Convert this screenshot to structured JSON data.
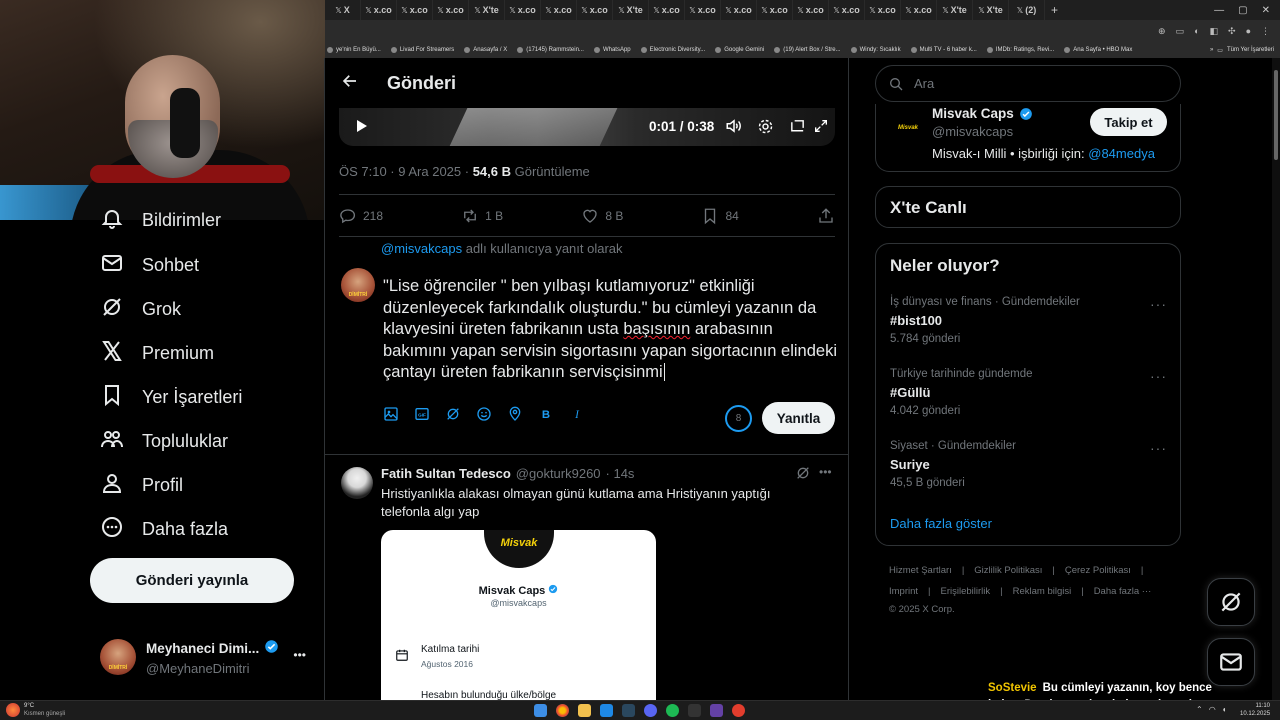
{
  "browser": {
    "tabs": [
      {
        "label": "X"
      },
      {
        "label": "x.co"
      },
      {
        "label": "x.co"
      },
      {
        "label": "x.co"
      },
      {
        "label": "X'te"
      },
      {
        "label": "x.co"
      },
      {
        "label": "x.co"
      },
      {
        "label": "x.co"
      },
      {
        "label": "X'te"
      },
      {
        "label": "x.co"
      },
      {
        "label": "x.co"
      },
      {
        "label": "x.co"
      },
      {
        "label": "x.co"
      },
      {
        "label": "x.co"
      },
      {
        "label": "x.co"
      },
      {
        "label": "x.co"
      },
      {
        "label": "x.co"
      },
      {
        "label": "X'te"
      },
      {
        "label": "X'te"
      },
      {
        "label": "(2)"
      }
    ],
    "new_tab": "+",
    "bookmarks": [
      "ye'nin En Büyü...",
      "Livad For Streamers",
      "Anasayfa / X",
      "(17145) Rammstein...",
      "WhatsApp",
      "Electronic Diversity...",
      "Google Gemini",
      "(19) Alert Box / Stre...",
      "Windy: Sıcaklık",
      "Multi TV - 6 haber k...",
      "IMDb: Ratings, Revi...",
      "Ana Sayfa • HBO Max"
    ],
    "bookmarks_more": "»",
    "all_bookmarks": "Tüm Yer İşaretleri"
  },
  "sidebar": {
    "items": [
      {
        "label": "Bildirimler",
        "icon": "bell-icon"
      },
      {
        "label": "Sohbet",
        "icon": "mail-icon"
      },
      {
        "label": "Grok",
        "icon": "grok-icon"
      },
      {
        "label": "Premium",
        "icon": "x-logo-icon"
      },
      {
        "label": "Yer İşaretleri",
        "icon": "bookmark-icon"
      },
      {
        "label": "Topluluklar",
        "icon": "communities-icon"
      },
      {
        "label": "Profil",
        "icon": "profile-icon"
      },
      {
        "label": "Daha fazla",
        "icon": "more-circle-icon"
      }
    ],
    "post_button": "Gönderi yayınla",
    "account": {
      "name": "Meyhaneci Dimi...",
      "handle": "@MeyhaneDimitri",
      "more": "•••",
      "avatar_label": "DİMİTRİ"
    }
  },
  "main": {
    "title": "Gönderi",
    "video": {
      "time": "0:01 / 0:38"
    },
    "meta": {
      "time": "ÖS 7:10 · 9 Ara 2025 ·",
      "views": "54,6 B",
      "views_label": "Görüntüleme"
    },
    "actions": {
      "replies": "218",
      "reposts": "1 B",
      "likes": "8 B",
      "bookmarks": "84"
    },
    "reply_to": {
      "handle": "@misvakcaps",
      "suffix": " adlı kullanıcıya yanıt olarak"
    },
    "compose": {
      "part1": "\"Lise öğrenciler \" ben yılbaşı kutlamıyoruz\" etkinliği düzenleyecek farkındalık oluşturdu.\" bu cümleyi yazanın da klavyesini üreten fabrikanın usta ",
      "err": "başısının",
      "part2": " arabasının bakımını yapan servisin sigortasını yapan sigortacının elindeki çantayı üreten fabrikanın servisçisinmi",
      "counter": "8",
      "reply_button": "Yanıtla"
    },
    "tweet": {
      "name": "Fatih Sultan Tedesco",
      "handle": "@gokturk9260",
      "time": "· 14s",
      "more": "•••",
      "text": "Hristiyanlıkla alakası olmayan günü kutlama ama Hristiyanın yaptığı telefonla algı yap",
      "card": {
        "logo": "Misvak",
        "name": "Misvak Caps",
        "handle": "@misvakcaps",
        "joined_label": "Katılma tarihi",
        "joined_value": "Ağustos 2016",
        "location_label": "Hesabın bulunduğu ülke/bölge"
      }
    }
  },
  "right": {
    "search_placeholder": "Ara",
    "who_to_follow": {
      "name": "Misvak Caps",
      "handle": "@misvakcaps",
      "bio": "Misvak-ı Milli • işbirliği için:",
      "bio_link": "@84medya",
      "follow": "Takip et"
    },
    "live_title": "X'te Canlı",
    "trends_title": "Neler oluyor?",
    "trends": [
      {
        "category": "İş dünyası ve finans · Gündemdekiler",
        "name": "#bist100",
        "count": "5.784 gönderi"
      },
      {
        "category": "Türkiye tarihinde gündemde",
        "name": "#Güllü",
        "count": "4.042 gönderi"
      },
      {
        "category": "Siyaset · Gündemdekiler",
        "name": "Suriye",
        "count": "45,5 B gönderi"
      }
    ],
    "show_more": "Daha fazla göster",
    "footer1": [
      "Hizmet Şartları",
      "|",
      "Gizlilik Politikası",
      "|",
      "Çerez Politikası",
      "|"
    ],
    "footer2": [
      "Imprint",
      "|",
      "Erişilebilirlik",
      "|",
      "Reklam bilgisi",
      "|",
      "Daha fazla ···"
    ],
    "copyright": "© 2025 X Corp."
  },
  "overlay": {
    "who": "SoStevie",
    "text": "Bu cümleyi yazanın, koy bence balım. Da olmasın baş belaya girmesin"
  },
  "taskbar": {
    "weather_temp": "9°C",
    "weather_desc": "Kısmen güneşli",
    "clock_time": "11:10",
    "clock_date": "10.12.2025"
  }
}
